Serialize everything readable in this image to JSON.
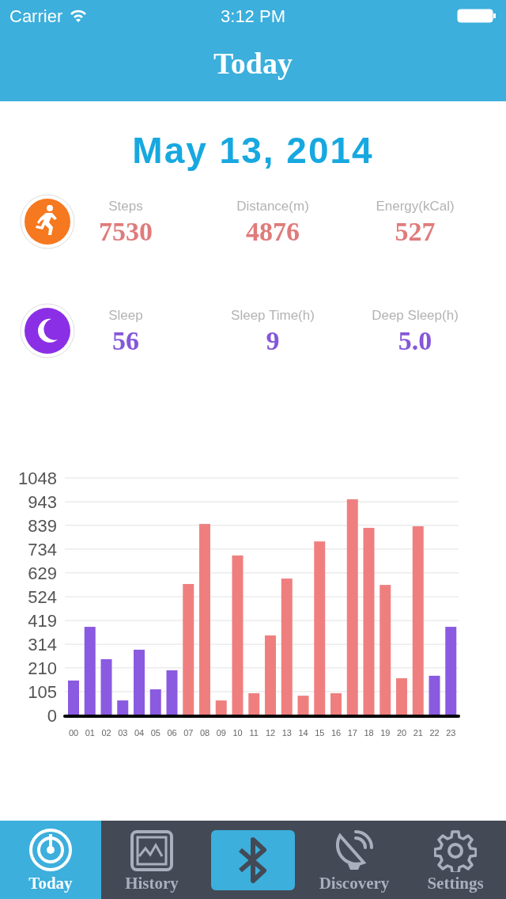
{
  "status_bar": {
    "carrier": "Carrier",
    "time": "3:12 PM"
  },
  "nav": {
    "title": "Today"
  },
  "date": "May 13, 2014",
  "stat_rows": [
    {
      "kind": "activity",
      "color": "#e07b7b",
      "stats": [
        {
          "label": "Steps",
          "value": "7530"
        },
        {
          "label": "Distance(m)",
          "value": "4876"
        },
        {
          "label": "Energy(kCal)",
          "value": "527"
        }
      ]
    },
    {
      "kind": "sleep",
      "color": "#8557d9",
      "stats": [
        {
          "label": "Sleep",
          "value": "56"
        },
        {
          "label": "Sleep Time(h)",
          "value": "9"
        },
        {
          "label": "Deep Sleep(h)",
          "value": "5.0"
        }
      ]
    }
  ],
  "chart_data": {
    "type": "bar",
    "stacked": true,
    "categories": [
      "00",
      "01",
      "02",
      "03",
      "04",
      "05",
      "06",
      "07",
      "08",
      "09",
      "10",
      "11",
      "12",
      "13",
      "14",
      "15",
      "16",
      "17",
      "18",
      "19",
      "20",
      "21",
      "22",
      "23"
    ],
    "ylim": [
      0,
      1048
    ],
    "grid": true,
    "yticks": [
      0,
      105,
      210,
      314,
      419,
      524,
      629,
      734,
      839,
      943,
      1048
    ],
    "series": [
      {
        "color": "#8a5ae0",
        "values": [
          154,
          391,
          248,
          66,
          290,
          115,
          199,
          null,
          null,
          null,
          null,
          null,
          null,
          null,
          null,
          null,
          null,
          null,
          null,
          null,
          null,
          null,
          175,
          391
        ]
      },
      {
        "color": "#ef7f7f",
        "values": [
          null,
          null,
          null,
          null,
          null,
          null,
          null,
          580,
          845,
          66,
          706,
          98,
          353,
          604,
          87,
          768,
          98,
          954,
          828,
          576,
          164,
          835,
          null,
          null
        ]
      }
    ]
  },
  "tabs": [
    {
      "kind": "tab",
      "label": "Today",
      "selected": true
    },
    {
      "kind": "tab",
      "label": "History",
      "selected": false
    },
    {
      "kind": "button",
      "selected": false
    },
    {
      "kind": "tab",
      "label": "Discovery",
      "selected": false
    },
    {
      "kind": "tab",
      "label": "Settings",
      "selected": false
    }
  ]
}
